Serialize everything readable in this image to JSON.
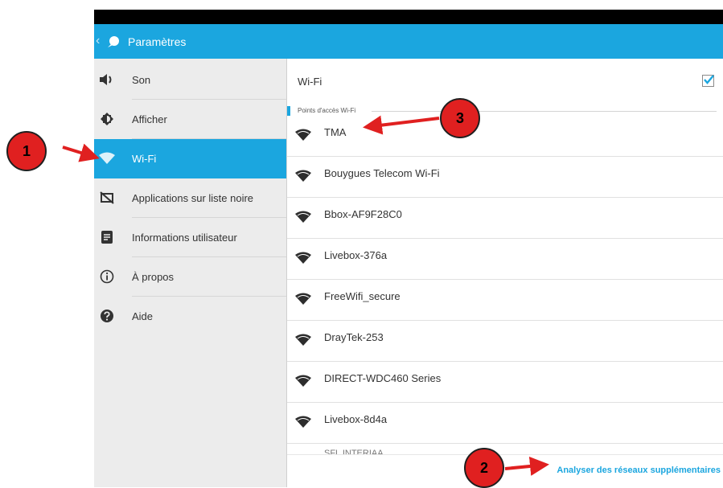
{
  "appbar": {
    "title": "Paramètres"
  },
  "sidebar": {
    "items": [
      {
        "label": "Son",
        "icon": "speaker-icon"
      },
      {
        "label": "Afficher",
        "icon": "display-icon"
      },
      {
        "label": "Wi-Fi",
        "icon": "wifi-icon",
        "selected": true
      },
      {
        "label": "Applications sur liste noire",
        "icon": "blocked-app-icon"
      },
      {
        "label": "Informations utilisateur",
        "icon": "user-info-icon"
      },
      {
        "label": "À propos",
        "icon": "info-icon"
      },
      {
        "label": "Aide",
        "icon": "help-icon"
      }
    ]
  },
  "content": {
    "wifi_label": "Wi-Fi",
    "wifi_enabled": true,
    "section_title": "Points d'accès Wi-Fi",
    "networks": [
      "TMA",
      "Bouygues Telecom Wi-Fi",
      "Bbox-AF9F28C0",
      "Livebox-376a",
      "FreeWifi_secure",
      "DrayTek-253",
      "DIRECT-WDC460 Series",
      "Livebox-8d4a"
    ],
    "partial_network": "SFL INTERIAA",
    "scan_label": "Analyser des réseaux supplémentaires"
  },
  "annotations": [
    "1",
    "2",
    "3"
  ],
  "colors": {
    "accent": "#1ba6df",
    "badge": "#e02020",
    "arrow": "#e02020"
  }
}
